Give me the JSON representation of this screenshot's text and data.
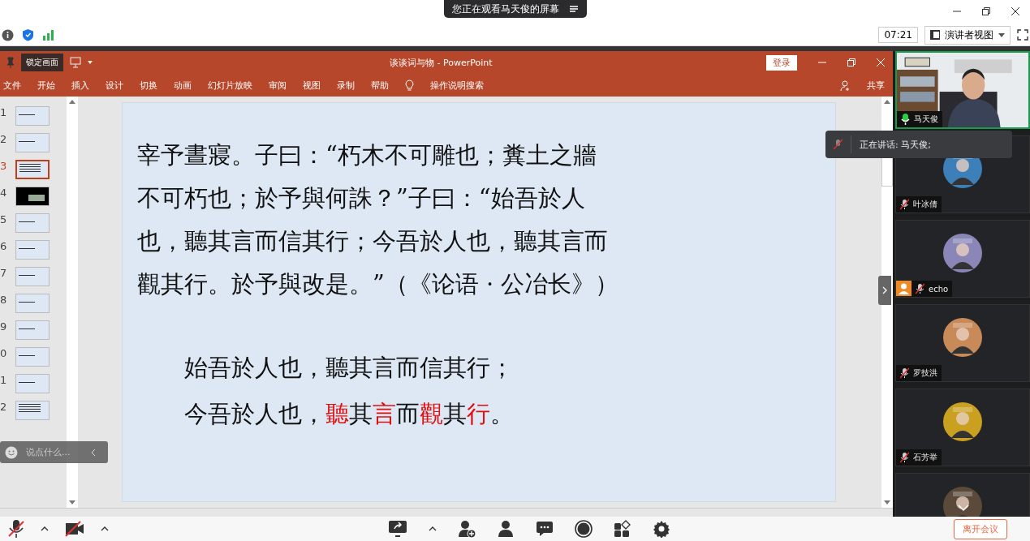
{
  "meeting_bar": {
    "banner": "您正在观看马天俊的屏幕",
    "time": "07:21",
    "view_menu": "演讲者视图"
  },
  "powerpoint": {
    "title": "谈谈词与物 - PowerPoint",
    "tooltip": "锁定画面",
    "login": "登录",
    "share": "共享",
    "search": "操作说明搜索",
    "menu": [
      "文件",
      "开始",
      "插入",
      "设计",
      "切换",
      "动画",
      "幻灯片放映",
      "审阅",
      "视图",
      "录制",
      "帮助"
    ],
    "thumbnails": [
      {
        "number": "1",
        "kind": "light",
        "selected": false
      },
      {
        "number": "2",
        "kind": "light",
        "selected": false
      },
      {
        "number": "3",
        "kind": "text",
        "selected": true
      },
      {
        "number": "4",
        "kind": "dark",
        "selected": false
      },
      {
        "number": "5",
        "kind": "light",
        "selected": false
      },
      {
        "number": "6",
        "kind": "light",
        "selected": false
      },
      {
        "number": "7",
        "kind": "light",
        "selected": false
      },
      {
        "number": "8",
        "kind": "light",
        "selected": false
      },
      {
        "number": "9",
        "kind": "light",
        "selected": false
      },
      {
        "number": "0",
        "kind": "light",
        "selected": false
      },
      {
        "number": "1",
        "kind": "light",
        "selected": false
      },
      {
        "number": "2",
        "kind": "text",
        "selected": false
      }
    ],
    "slide": {
      "paragraph": [
        "宰予晝寢。子曰：“朽木不可雕也；糞土之牆",
        "不可朽也；於予與何誅？”子曰：“始吾於人",
        "也，聽其言而信其行；今吾於人也，聽其言而",
        "觀其行。於予與改是。”（《论语 · 公冶长》）"
      ],
      "quote": [
        [
          {
            "text": "始吾於人也，聽其言而信其行；",
            "highlighted": false
          }
        ],
        [
          {
            "text": "今吾於人也，",
            "highlighted": false
          },
          {
            "text": "聽",
            "highlighted": true
          },
          {
            "text": "其",
            "highlighted": false
          },
          {
            "text": "言",
            "highlighted": true
          },
          {
            "text": "而",
            "highlighted": false
          },
          {
            "text": "觀",
            "highlighted": true
          },
          {
            "text": "其",
            "highlighted": false
          },
          {
            "text": "行",
            "highlighted": true
          },
          {
            "text": "。",
            "highlighted": false
          }
        ]
      ]
    }
  },
  "chat_box": {
    "placeholder": "说点什么..."
  },
  "speaking_toast": {
    "text": "正在讲话: 马天俊;"
  },
  "participants": [
    {
      "name": "马天俊",
      "kind": "video",
      "muted": false,
      "active": true
    },
    {
      "name": "叶冰倩",
      "kind": "avatar",
      "muted": true,
      "active": false
    },
    {
      "name": "echo",
      "kind": "avatar",
      "muted": true,
      "active": false
    },
    {
      "name": "罗技洪",
      "kind": "avatar",
      "muted": true,
      "active": false
    },
    {
      "name": "石芳举",
      "kind": "avatar",
      "muted": true,
      "active": false
    },
    {
      "kind": "avatar",
      "active": false
    }
  ],
  "toolbar": {
    "mic_muted": true,
    "camera_muted": true,
    "leave": "离开会议"
  }
}
